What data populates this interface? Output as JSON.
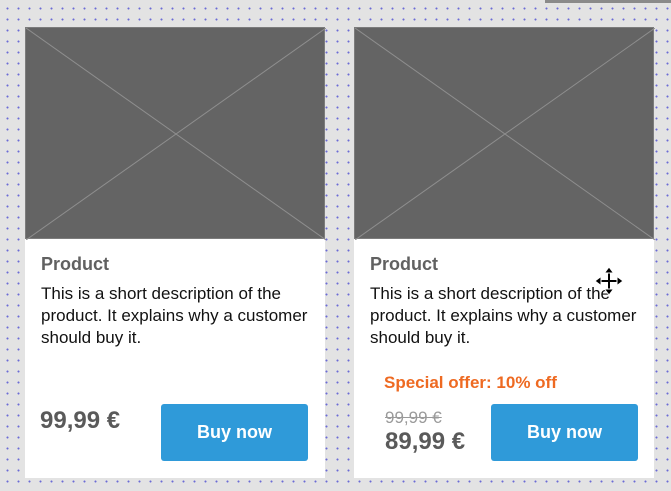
{
  "cards": [
    {
      "image_icon": "image-placeholder-icon",
      "title": "Product",
      "description": "This is a short description of the product. It explains why a customer should buy it.",
      "price": "99,99 €",
      "buy_label": "Buy now"
    },
    {
      "image_icon": "image-placeholder-icon",
      "title": "Product",
      "description": "This is a short description of the product. It explains why a customer should buy it.",
      "offer": "Special offer: 10% off",
      "old_price": "99,99 €",
      "new_price": "89,99 €",
      "buy_label": "Buy now"
    }
  ],
  "cursor_icon": "move-cursor-icon",
  "colors": {
    "button": "#2f9ad9",
    "offer": "#ee6a22",
    "placeholder": "#646464"
  }
}
